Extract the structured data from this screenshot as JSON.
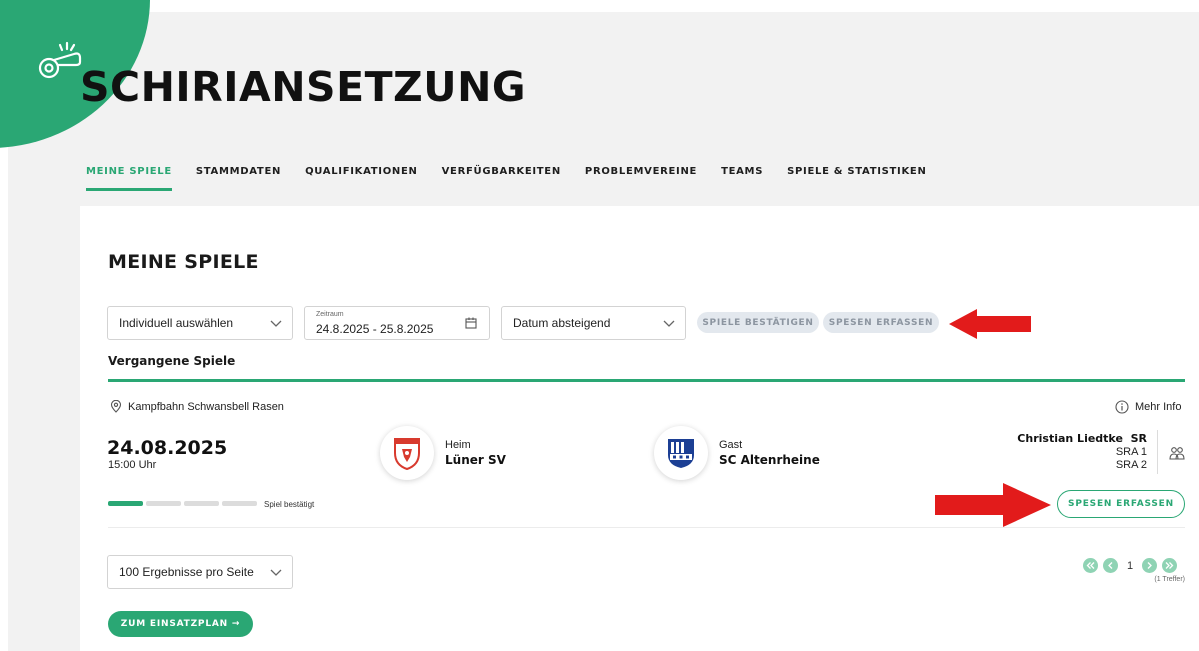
{
  "app": {
    "title": "SCHIRIANSETZUNG",
    "logo_icon": "whistle-icon",
    "brand_color": "#2aa774"
  },
  "nav": {
    "items": [
      {
        "label": "MEINE SPIELE",
        "active": true
      },
      {
        "label": "STAMMDATEN",
        "active": false
      },
      {
        "label": "QUALIFIKATIONEN",
        "active": false
      },
      {
        "label": "VERFÜGBARKEITEN",
        "active": false
      },
      {
        "label": "PROBLEMVEREINE",
        "active": false
      },
      {
        "label": "TEAMS",
        "active": false
      },
      {
        "label": "SPIELE & STATISTIKEN",
        "active": false
      }
    ]
  },
  "page": {
    "title": "MEINE SPIELE",
    "filters": {
      "selection": {
        "value": "Individuell auswählen",
        "icon": "chevron-down-icon"
      },
      "range": {
        "label": "Zeitraum",
        "value": "24.8.2025 - 25.8.2025",
        "icon": "calendar-icon"
      },
      "sort": {
        "value": "Datum absteigend",
        "icon": "chevron-down-icon"
      }
    },
    "actions": {
      "confirm_games": "SPIELE BESTÄTIGEN",
      "record_expenses": "SPESEN ERFASSEN"
    },
    "annotation": {
      "arrow_color": "#e21b1b"
    },
    "section_label": "Vergangene Spiele"
  },
  "match": {
    "venue": "Kampfbahn Schwansbell Rasen",
    "venue_icon": "location-pin-icon",
    "more_info": "Mehr Info",
    "more_info_icon": "info-icon",
    "date": "24.08.2025",
    "time": "15:00 Uhr",
    "home": {
      "role": "Heim",
      "name": "Lüner SV",
      "crest_color": "#d83a2e"
    },
    "away": {
      "role": "Gast",
      "name": "SC Altenrheine",
      "crest_color": "#1c3f94"
    },
    "referees": {
      "name": "Christian Liedtke",
      "roles": [
        "SR",
        "SRA 1",
        "SRA 2"
      ],
      "icon": "team-icon"
    },
    "status": {
      "label": "Spiel bestätigt",
      "steps_total": 4,
      "steps_done": 1
    },
    "expenses_button": "SPESEN ERFASSEN"
  },
  "footer": {
    "page_size": {
      "value": "100 Ergebnisse pro Seite",
      "icon": "chevron-down-icon"
    },
    "pagination": {
      "current_page": "1",
      "hits": "(1 Treffer)"
    },
    "cta": "ZUM EINSATZPLAN →"
  }
}
